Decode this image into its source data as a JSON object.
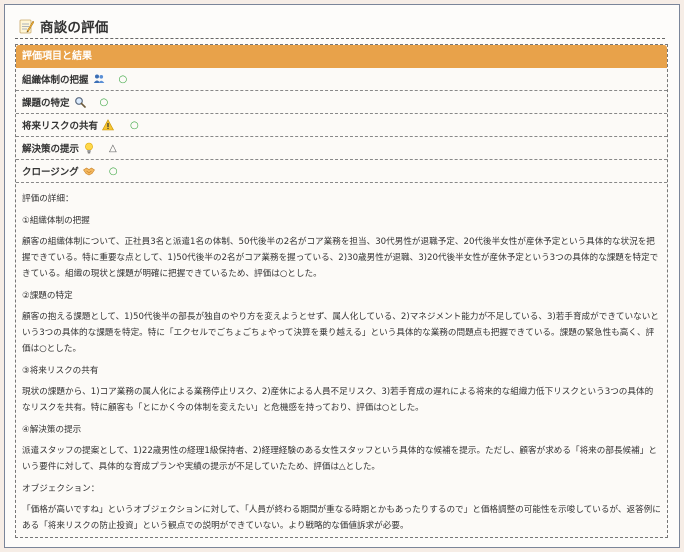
{
  "title": {
    "text": "商談の評価",
    "icon": "memo-icon"
  },
  "evaluation": {
    "header": "評価項目と結果",
    "items": [
      {
        "label": "組織体制の把握",
        "icon": "people-icon",
        "mark": "○"
      },
      {
        "label": "課題の特定",
        "icon": "magnifier-icon",
        "mark": "○"
      },
      {
        "label": "将来リスクの共有",
        "icon": "warning-icon",
        "mark": "○"
      },
      {
        "label": "解決策の提示",
        "icon": "lightbulb-icon",
        "mark": "△"
      },
      {
        "label": "クロージング",
        "icon": "handshake-icon",
        "mark": "○"
      }
    ]
  },
  "details": {
    "intro": "評価の詳細：",
    "sections": [
      {
        "heading": "①組織体制の把握",
        "body": "顧客の組織体制について、正社員3名と派遣1名の体制、50代後半の2名がコア業務を担当、30代男性が退職予定、20代後半女性が産休予定という具体的な状況を把握できている。特に重要な点として、1)50代後半の2名がコア業務を握っている、2)30歳男性が退職、3)20代後半女性が産休予定という3つの具体的な課題を特定できている。組織の現状と課題が明確に把握できているため、評価は○とした。"
      },
      {
        "heading": "②課題の特定",
        "body": "顧客の抱える課題として、1)50代後半の部長が独自のやり方を変えようとせず、属人化している、2)マネジメント能力が不足している、3)若手育成ができていないという3つの具体的な課題を特定。特に「エクセルでごちょごちょやって決算を乗り越える」という具体的な業務の問題点も把握できている。課題の緊急性も高く、評価は○とした。"
      },
      {
        "heading": "③将来リスクの共有",
        "body": "現状の課題から、1)コア業務の属人化による業務停止リスク、2)産休による人員不足リスク、3)若手育成の遅れによる将来的な組織力低下リスクという3つの具体的なリスクを共有。特に顧客も「とにかく今の体制を変えたい」と危機感を持っており、評価は○とした。"
      },
      {
        "heading": "④解決策の提示",
        "body": "派遣スタッフの提案として、1)22歳男性の経理1級保持者、2)経理経験のある女性スタッフという具体的な候補を提示。ただし、顧客が求める「将来の部長候補」という要件に対して、具体的な育成プランや実績の提示が不足していたため、評価は△とした。"
      },
      {
        "heading": "オブジェクション：",
        "body": "「価格が高いですね」というオブジェクションに対して、「人員が終わる期間が重なる時期とかもあったりするので」と価格調整の可能性を示唆しているが、返答例にある「将来リスクの防止投資」という観点での説明ができていない。より戦略的な価値訴求が必要。"
      }
    ]
  },
  "colors": {
    "header_bg": "#e8a24a",
    "circle_mark": "#3aa641",
    "page_bg": "#f6ede6"
  }
}
